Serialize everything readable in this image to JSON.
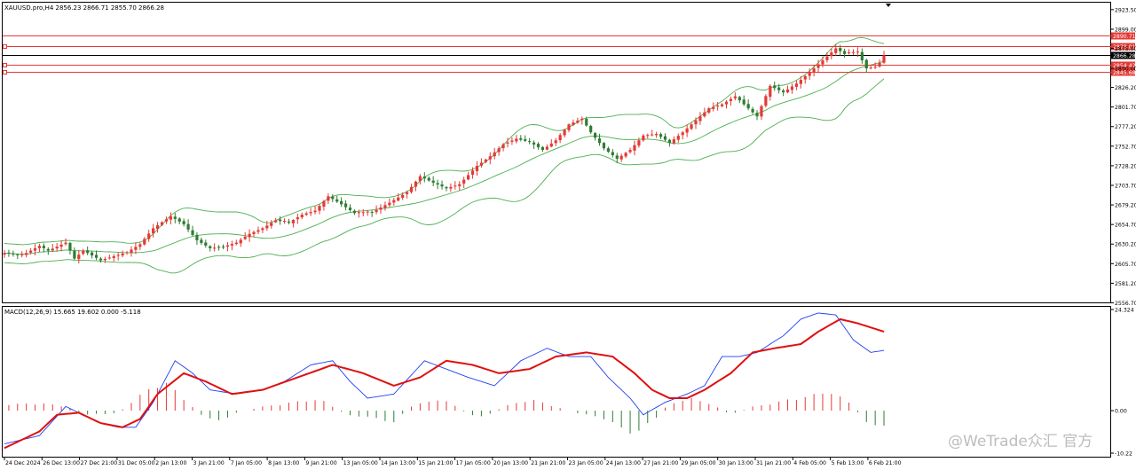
{
  "main_header": "XAUUSD.pro,H4  2856.23 2866.71 2855.70 2866.28",
  "macd_header": "MACD(12,26,9) 15.665 19.602 0.000 -5.118",
  "watermark": "@WeTrade众汇 官方",
  "colors": {
    "up_candle": "#e53935",
    "down_candle": "#2e7d32",
    "bollinger": "#4caf50",
    "hline": "#e53935",
    "price_tag": "#e53935",
    "current_line": "#000000",
    "macd_line": "#1e3ff0",
    "signal_line": "#e01010",
    "hist_up": "#e53935",
    "hist_down": "#2e7d32"
  },
  "chart_data": [
    {
      "type": "candlestick",
      "symbol": "XAUUSD.pro",
      "timeframe": "H4",
      "ylim": [
        2556.7,
        2925.0
      ],
      "y_ticks": [
        "2923.50",
        "2899.00",
        "2875.00",
        "2850.00",
        "2826.20",
        "2801.70",
        "2777.20",
        "2752.70",
        "2728.20",
        "2703.70",
        "2679.20",
        "2654.70",
        "2630.20",
        "2605.70",
        "2581.20",
        "2556.70"
      ],
      "x_tick_labels": [
        "24 Dec 2024",
        "26 Dec 13:00",
        "27 Dec 21:00",
        "31 Dec 05:00",
        "2 Jan 13:00",
        "3 Jan 21:00",
        "7 Jan 05:00",
        "8 Jan 13:00",
        "9 Jan 21:00",
        "13 Jan 05:00",
        "14 Jan 13:00",
        "15 Jan 21:00",
        "17 Jan 05:00",
        "20 Jan 13:00",
        "21 Jan 21:00",
        "23 Jan 05:00",
        "24 Jan 13:00",
        "27 Jan 21:00",
        "29 Jan 05:00",
        "30 Jan 13:00",
        "31 Jan 21:00",
        "4 Feb 05:00",
        "5 Feb 13:00",
        "6 Feb 21:00"
      ],
      "horizontal_levels": [
        {
          "price": 2890.71,
          "label": "2890.71",
          "marker": false
        },
        {
          "price": 2878.01,
          "label": "2878.01",
          "marker": true
        },
        {
          "price": 2854.42,
          "label": "2854.42",
          "marker": true
        },
        {
          "price": 2845.68,
          "label": "2845.68",
          "marker": true
        }
      ],
      "current_price": {
        "price": 2866.28,
        "label": "2866.28"
      },
      "close_path": [
        [
          0,
          2619
        ],
        [
          4,
          2616
        ],
        [
          8,
          2628
        ],
        [
          10,
          2622
        ],
        [
          14,
          2632
        ],
        [
          16,
          2612
        ],
        [
          18,
          2622
        ],
        [
          22,
          2610
        ],
        [
          25,
          2615
        ],
        [
          28,
          2620
        ],
        [
          31,
          2630
        ],
        [
          34,
          2650
        ],
        [
          38,
          2665
        ],
        [
          41,
          2655
        ],
        [
          44,
          2635
        ],
        [
          47,
          2625
        ],
        [
          50,
          2627
        ],
        [
          53,
          2632
        ],
        [
          56,
          2643
        ],
        [
          59,
          2650
        ],
        [
          62,
          2660
        ],
        [
          65,
          2657
        ],
        [
          68,
          2667
        ],
        [
          71,
          2672
        ],
        [
          74,
          2690
        ],
        [
          77,
          2680
        ],
        [
          80,
          2669
        ],
        [
          84,
          2670
        ],
        [
          88,
          2682
        ],
        [
          92,
          2695
        ],
        [
          95,
          2715
        ],
        [
          98,
          2707
        ],
        [
          101,
          2700
        ],
        [
          104,
          2705
        ],
        [
          108,
          2728
        ],
        [
          111,
          2740
        ],
        [
          114,
          2755
        ],
        [
          117,
          2762
        ],
        [
          120,
          2758
        ],
        [
          123,
          2748
        ],
        [
          126,
          2760
        ],
        [
          129,
          2780
        ],
        [
          132,
          2787
        ],
        [
          134,
          2770
        ],
        [
          137,
          2750
        ],
        [
          140,
          2737
        ],
        [
          143,
          2748
        ],
        [
          146,
          2766
        ],
        [
          149,
          2768
        ],
        [
          152,
          2757
        ],
        [
          155,
          2770
        ],
        [
          158,
          2785
        ],
        [
          161,
          2800
        ],
        [
          164,
          2805
        ],
        [
          167,
          2815
        ],
        [
          170,
          2800
        ],
        [
          172,
          2790
        ],
        [
          175,
          2828
        ],
        [
          178,
          2820
        ],
        [
          181,
          2831
        ],
        [
          184,
          2845
        ],
        [
          187,
          2860
        ],
        [
          190,
          2875
        ],
        [
          192,
          2868
        ],
        [
          195,
          2870
        ],
        [
          197,
          2850
        ],
        [
          199,
          2852
        ],
        [
          200,
          2857
        ],
        [
          201,
          2866.28
        ]
      ]
    },
    {
      "type": "macd",
      "params": "12,26,9",
      "ylim": [
        -10.22,
        24.324
      ],
      "y_ticks": [
        "24.324",
        "0.00",
        "-10.22"
      ],
      "values": {
        "main": 15.665,
        "signal": 19.602,
        "value3": 0.0,
        "value4": -5.118
      },
      "macd_path": [
        [
          0,
          -8
        ],
        [
          8,
          -6
        ],
        [
          14,
          1
        ],
        [
          18,
          -1
        ],
        [
          22,
          -3
        ],
        [
          26,
          -4
        ],
        [
          30,
          -4
        ],
        [
          34,
          2
        ],
        [
          39,
          12
        ],
        [
          43,
          9
        ],
        [
          47,
          5
        ],
        [
          53,
          4
        ],
        [
          59,
          5
        ],
        [
          64,
          7
        ],
        [
          70,
          11
        ],
        [
          75,
          12
        ],
        [
          79,
          7
        ],
        [
          83,
          3
        ],
        [
          89,
          4
        ],
        [
          96,
          12
        ],
        [
          101,
          10
        ],
        [
          106,
          8
        ],
        [
          112,
          6
        ],
        [
          118,
          12
        ],
        [
          124,
          15
        ],
        [
          129,
          13
        ],
        [
          134,
          13
        ],
        [
          138,
          8
        ],
        [
          143,
          3
        ],
        [
          146,
          -1
        ],
        [
          151,
          2
        ],
        [
          156,
          4
        ],
        [
          160,
          6
        ],
        [
          164,
          13
        ],
        [
          168,
          13
        ],
        [
          172,
          14
        ],
        [
          175,
          16
        ],
        [
          178,
          18
        ],
        [
          182,
          22
        ],
        [
          186,
          23.5
        ],
        [
          190,
          23
        ],
        [
          194,
          17
        ],
        [
          198,
          14
        ],
        [
          201,
          14.5
        ]
      ],
      "signal_path": [
        [
          0,
          -9
        ],
        [
          8,
          -5
        ],
        [
          12,
          -1
        ],
        [
          17,
          -0.5
        ],
        [
          22,
          -3
        ],
        [
          27,
          -4
        ],
        [
          31,
          -2
        ],
        [
          35,
          4
        ],
        [
          41,
          9
        ],
        [
          46,
          7
        ],
        [
          52,
          4
        ],
        [
          59,
          5
        ],
        [
          67,
          8
        ],
        [
          75,
          11
        ],
        [
          82,
          9
        ],
        [
          89,
          6
        ],
        [
          95,
          8
        ],
        [
          101,
          12
        ],
        [
          107,
          11
        ],
        [
          113,
          9
        ],
        [
          120,
          10
        ],
        [
          126,
          13
        ],
        [
          133,
          14
        ],
        [
          139,
          13
        ],
        [
          144,
          9
        ],
        [
          148,
          5
        ],
        [
          152,
          3
        ],
        [
          156,
          3
        ],
        [
          160,
          5
        ],
        [
          166,
          9
        ],
        [
          171,
          14
        ],
        [
          176,
          15
        ],
        [
          182,
          16
        ],
        [
          186,
          19
        ],
        [
          191,
          22
        ],
        [
          195,
          21
        ],
        [
          198,
          20
        ],
        [
          201,
          19
        ]
      ],
      "hist_envelope": [
        [
          0,
          1.5
        ],
        [
          8,
          2
        ],
        [
          14,
          1
        ],
        [
          18,
          -1
        ],
        [
          22,
          -1
        ],
        [
          26,
          -0.5
        ],
        [
          30,
          3
        ],
        [
          36,
          8
        ],
        [
          41,
          3
        ],
        [
          45,
          -1
        ],
        [
          49,
          -3
        ],
        [
          53,
          -0.5
        ],
        [
          59,
          1
        ],
        [
          65,
          2
        ],
        [
          72,
          3
        ],
        [
          78,
          -1
        ],
        [
          85,
          -2
        ],
        [
          89,
          -3
        ],
        [
          93,
          1
        ],
        [
          98,
          3
        ],
        [
          102,
          2
        ],
        [
          106,
          -1
        ],
        [
          110,
          -1.5
        ],
        [
          114,
          1
        ],
        [
          120,
          3
        ],
        [
          126,
          1
        ],
        [
          132,
          -1
        ],
        [
          136,
          -1.5
        ],
        [
          140,
          -4
        ],
        [
          144,
          -6
        ],
        [
          148,
          -3
        ],
        [
          152,
          2
        ],
        [
          157,
          3
        ],
        [
          161,
          2
        ],
        [
          166,
          -1
        ],
        [
          171,
          1
        ],
        [
          176,
          2
        ],
        [
          180,
          3
        ],
        [
          185,
          4
        ],
        [
          189,
          5
        ],
        [
          193,
          2
        ],
        [
          197,
          -3
        ],
        [
          201,
          -4
        ]
      ]
    }
  ]
}
